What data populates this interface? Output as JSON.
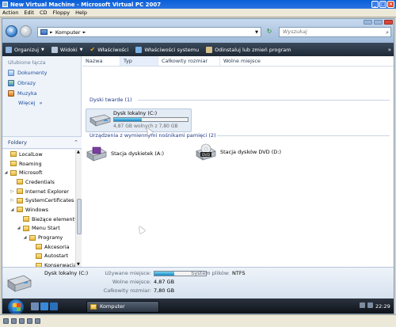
{
  "host": {
    "title": "New Virtual Machine - Microsoft Virtual PC 2007",
    "menu": [
      "Action",
      "Edit",
      "CD",
      "Floppy",
      "Help"
    ]
  },
  "address": {
    "path": "Komputer",
    "separator": "►",
    "search_placeholder": "Wyszukaj"
  },
  "toolbar": {
    "items": [
      "Organizuj",
      "Widoki",
      "Właściwości",
      "Właściwości systemu",
      "Odinstaluj lub zmień program"
    ]
  },
  "favorites": {
    "header": "Ulubione łącza",
    "items": [
      "Dokumenty",
      "Obrazy",
      "Muzyka"
    ],
    "more": "Więcej",
    "more_arrow": "»"
  },
  "folders": {
    "header": "Foldery",
    "chevron": "⌃",
    "tree": [
      {
        "label": "LocalLow",
        "level": 0,
        "arrow": ""
      },
      {
        "label": "Roaming",
        "level": 0,
        "arrow": ""
      },
      {
        "label": "Microsoft",
        "level": 0,
        "arrow": "◢"
      },
      {
        "label": "Credentials",
        "level": 1,
        "arrow": ""
      },
      {
        "label": "Internet Explorer",
        "level": 1,
        "arrow": "▷"
      },
      {
        "label": "SystemCertificates",
        "level": 1,
        "arrow": "▷"
      },
      {
        "label": "Windows",
        "level": 1,
        "arrow": "◢"
      },
      {
        "label": "Bieżące elementy",
        "level": 2,
        "arrow": ""
      },
      {
        "label": "Menu Start",
        "level": 2,
        "arrow": "◢"
      },
      {
        "label": "Programy",
        "level": 3,
        "arrow": "◢"
      },
      {
        "label": "Akcesoria",
        "level": 4,
        "arrow": ""
      },
      {
        "label": "Autostart",
        "level": 4,
        "arrow": ""
      },
      {
        "label": "Konserwacja",
        "level": 4,
        "arrow": ""
      },
      {
        "label": "Narzędzia adm",
        "level": 4,
        "arrow": ""
      }
    ]
  },
  "columns": [
    "Nazwa",
    "Typ",
    "Całkowity rozmiar",
    "Wolne miejsce"
  ],
  "groups": {
    "hard_drives": "Dyski twarde (1)",
    "removable": "Urządzenia z wymiennymi nośnikami pamięci (2)"
  },
  "drive": {
    "name": "Dysk lokalny (C:)",
    "space": "4,87 GB wolnych z 7,80 GB",
    "used_fraction": 0.38
  },
  "removable": [
    {
      "name": "Stacja dyskietek (A:)",
      "icon": "floppy-drive-icon"
    },
    {
      "name": "Stacja dysków DVD (D:)",
      "icon": "dvd-drive-icon",
      "badge": "DVD"
    }
  ],
  "details": {
    "name": "Dysk lokalny (C:)",
    "used_label": "Używane miejsce:",
    "free_label": "Wolne miejsce:",
    "free_value": "4,87 GB",
    "total_label": "Całkowity rozmiar:",
    "total_value": "7,80 GB",
    "fs_label": "System plików:",
    "fs_value": "NTFS",
    "used_fraction": 0.38
  },
  "taskbar": {
    "window": "Komputer",
    "clock": "22:29"
  }
}
